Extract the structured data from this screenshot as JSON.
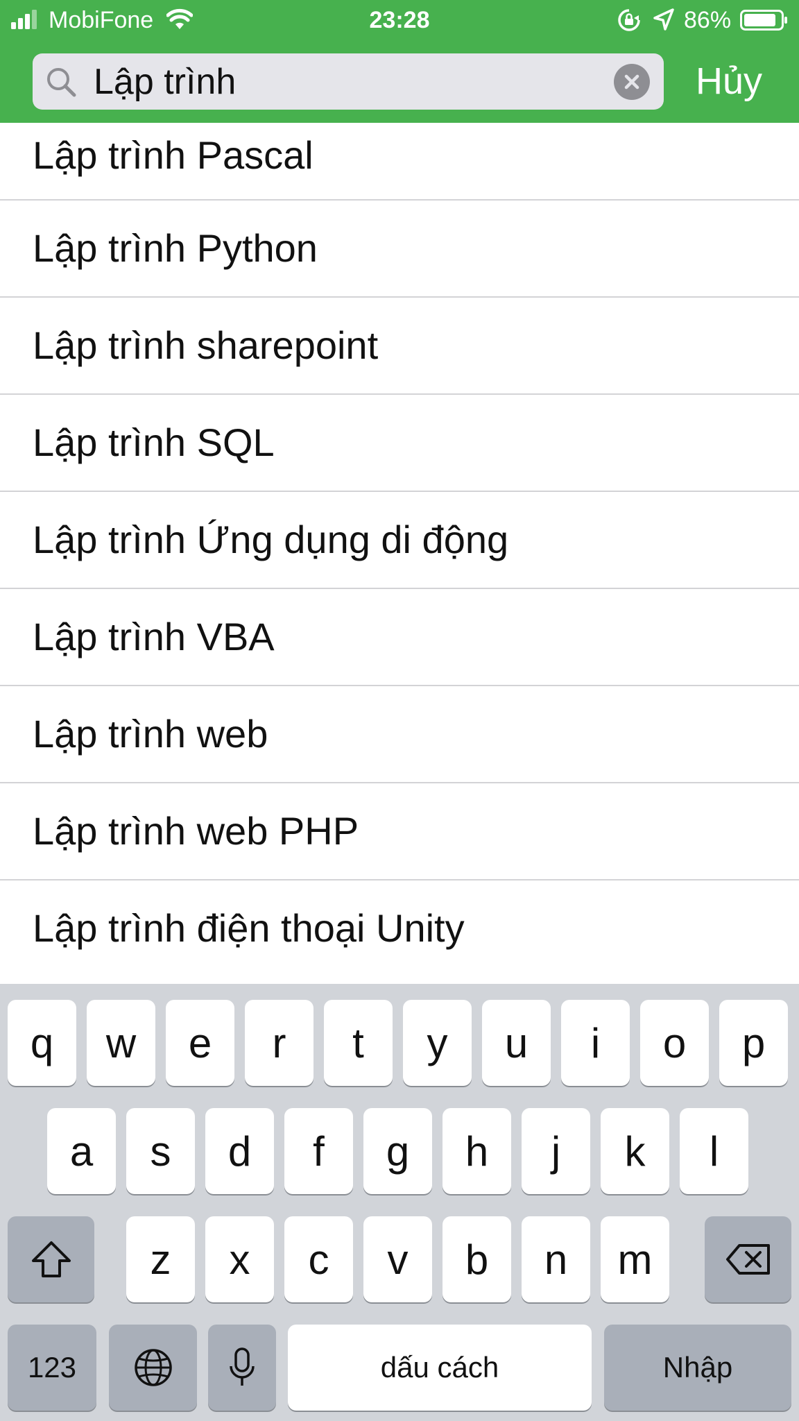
{
  "status_bar": {
    "carrier": "MobiFone",
    "time": "23:28",
    "battery_percent": "86%"
  },
  "search": {
    "query": "Lập trình",
    "cancel_label": "Hủy"
  },
  "suggestions": [
    "Lập trình Pascal",
    "Lập trình Python",
    "Lập trình sharepoint",
    "Lập trình SQL",
    "Lập trình Ứng dụng di động",
    "Lập trình VBA",
    "Lập trình web",
    "Lập trình web PHP",
    "Lập trình điện thoại Unity"
  ],
  "keyboard": {
    "row1": [
      "q",
      "w",
      "e",
      "r",
      "t",
      "y",
      "u",
      "i",
      "o",
      "p"
    ],
    "row2": [
      "a",
      "s",
      "d",
      "f",
      "g",
      "h",
      "j",
      "k",
      "l"
    ],
    "row3": [
      "z",
      "x",
      "c",
      "v",
      "b",
      "n",
      "m"
    ],
    "numbers_label": "123",
    "space_label": "dấu cách",
    "return_label": "Nhập"
  },
  "colors": {
    "header_green": "#47b14e",
    "keyboard_bg": "#d1d4d9"
  }
}
